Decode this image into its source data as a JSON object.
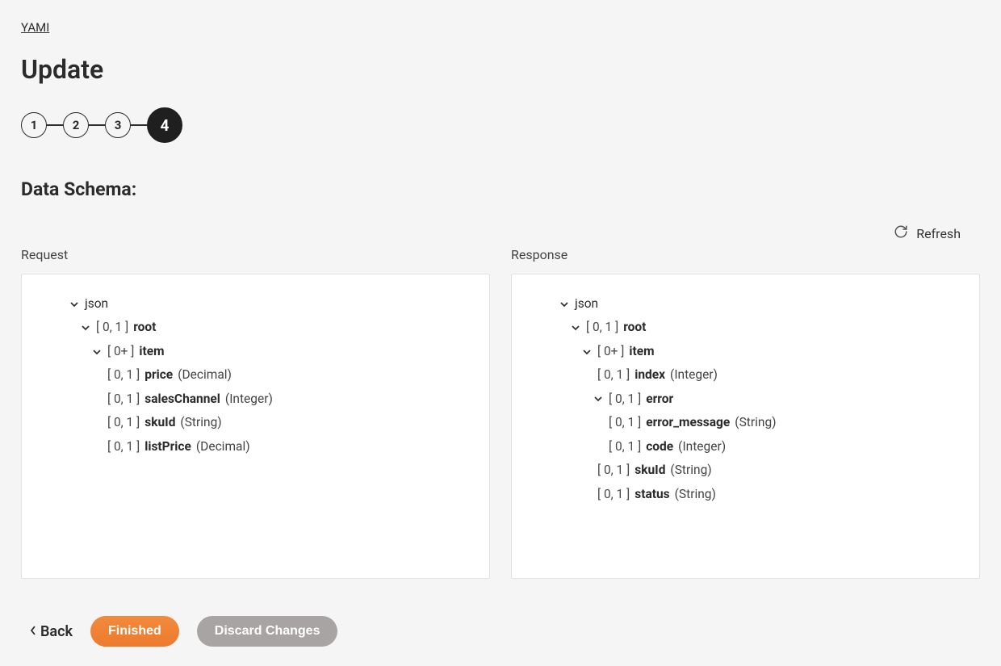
{
  "breadcrumb": "YAMI",
  "page_title": "Update",
  "steps": [
    "1",
    "2",
    "3",
    "4"
  ],
  "active_step_index": 3,
  "section_title": "Data Schema:",
  "refresh_label": "Refresh",
  "columns": {
    "request": {
      "header": "Request",
      "root_label": "json",
      "tree": {
        "root": {
          "card": "[ 0, 1 ]",
          "name": "root"
        },
        "item": {
          "card": "[ 0+ ]",
          "name": "item"
        },
        "fields": [
          {
            "card": "[ 0, 1 ]",
            "name": "price",
            "type": "(Decimal)"
          },
          {
            "card": "[ 0, 1 ]",
            "name": "salesChannel",
            "type": "(Integer)"
          },
          {
            "card": "[ 0, 1 ]",
            "name": "skuId",
            "type": "(String)"
          },
          {
            "card": "[ 0, 1 ]",
            "name": "listPrice",
            "type": "(Decimal)"
          }
        ]
      }
    },
    "response": {
      "header": "Response",
      "root_label": "json",
      "tree": {
        "root": {
          "card": "[ 0, 1 ]",
          "name": "root"
        },
        "item": {
          "card": "[ 0+ ]",
          "name": "item"
        },
        "index": {
          "card": "[ 0, 1 ]",
          "name": "index",
          "type": "(Integer)"
        },
        "error": {
          "card": "[ 0, 1 ]",
          "name": "error"
        },
        "error_fields": [
          {
            "card": "[ 0, 1 ]",
            "name": "error_message",
            "type": "(String)"
          },
          {
            "card": "[ 0, 1 ]",
            "name": "code",
            "type": "(Integer)"
          }
        ],
        "tail_fields": [
          {
            "card": "[ 0, 1 ]",
            "name": "skuId",
            "type": "(String)"
          },
          {
            "card": "[ 0, 1 ]",
            "name": "status",
            "type": "(String)"
          }
        ]
      }
    }
  },
  "footer": {
    "back": "Back",
    "finished": "Finished",
    "discard": "Discard Changes"
  }
}
